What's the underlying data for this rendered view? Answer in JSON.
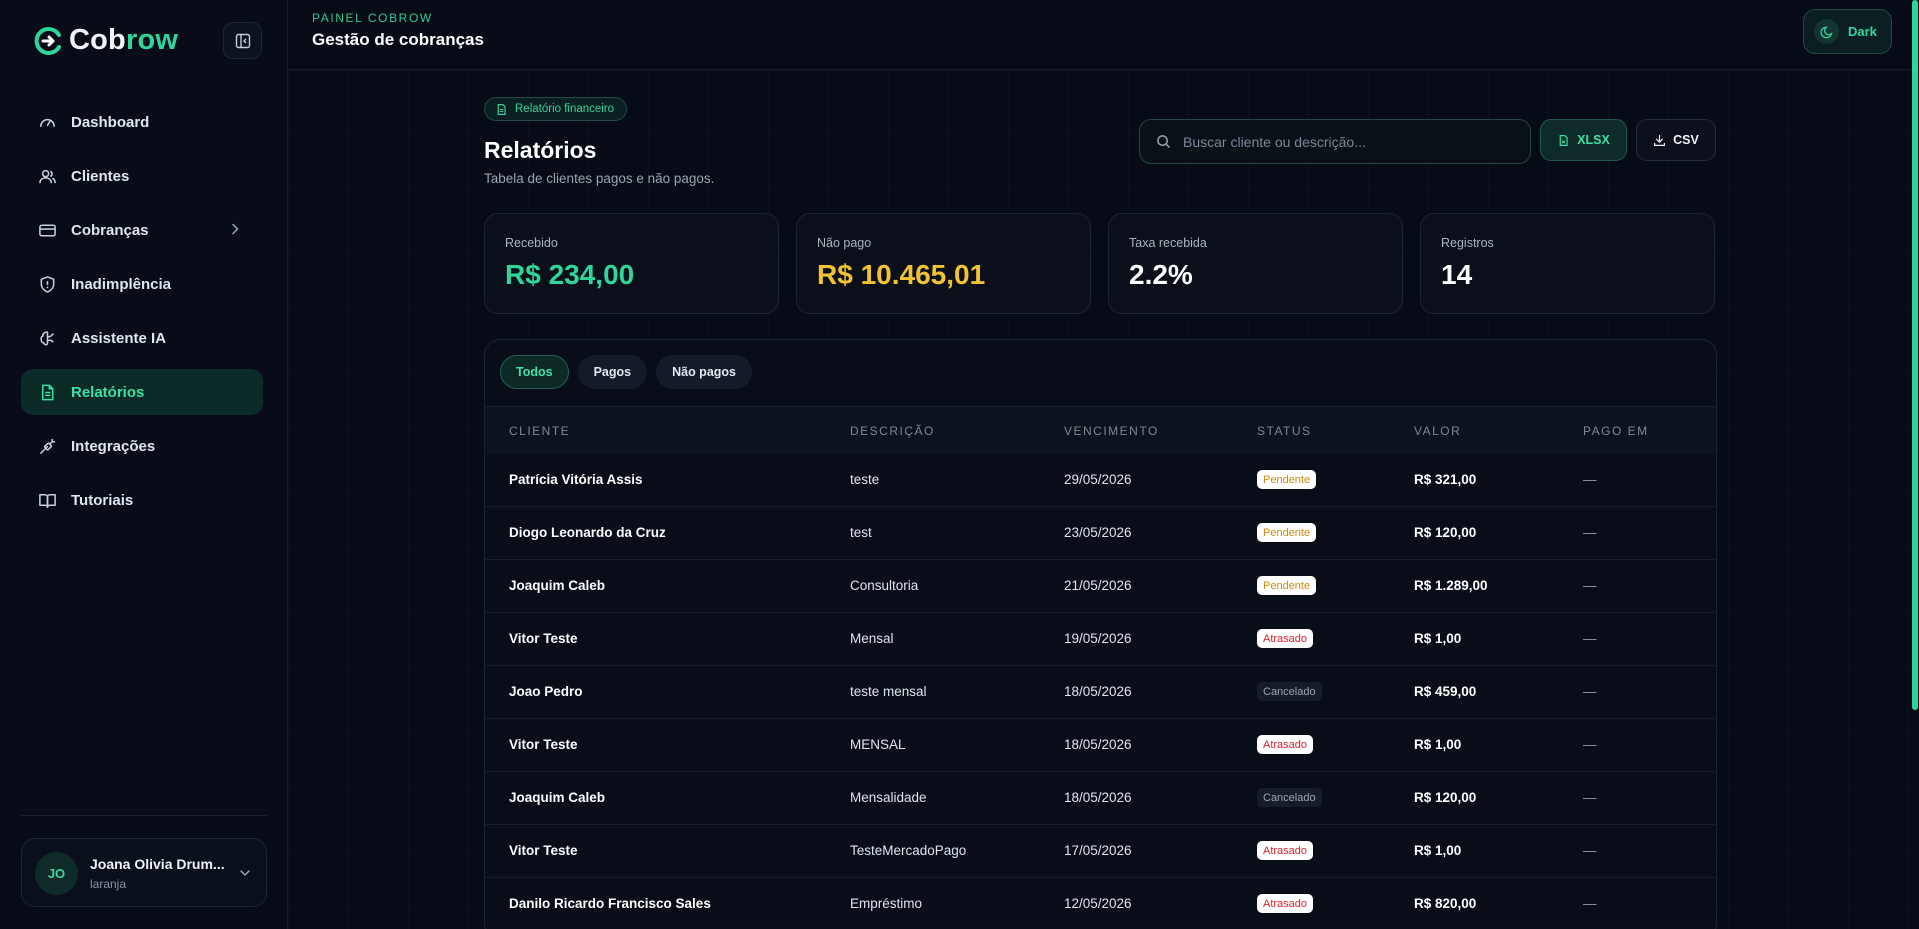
{
  "brand": {
    "part1": "Cob",
    "part2": "row"
  },
  "sidebar": {
    "items": [
      {
        "label": "Dashboard",
        "icon": "gauge-icon"
      },
      {
        "label": "Clientes",
        "icon": "users-icon"
      },
      {
        "label": "Cobranças",
        "icon": "credit-card-icon"
      },
      {
        "label": "Inadimplência",
        "icon": "shield-alert-icon"
      },
      {
        "label": "Assistente IA",
        "icon": "brain-icon"
      },
      {
        "label": "Relatórios",
        "icon": "file-text-icon"
      },
      {
        "label": "Integrações",
        "icon": "plug-icon"
      },
      {
        "label": "Tutoriais",
        "icon": "book-open-icon"
      }
    ],
    "active": "Relatórios"
  },
  "user": {
    "initials": "JO",
    "name": "Joana Olivia Drum...",
    "sub": "laranja"
  },
  "header": {
    "eyebrow": "PAINEL COBROW",
    "title": "Gestão de cobranças",
    "theme_label": "Dark"
  },
  "page": {
    "badge": "Relatório financeiro",
    "title": "Relatórios",
    "subtitle": "Tabela de clientes pagos e não pagos.",
    "search_placeholder": "Buscar cliente ou descrição...",
    "xlsx_label": "XLSX",
    "csv_label": "CSV"
  },
  "stats": [
    {
      "label": "Recebido",
      "value": "R$ 234,00",
      "color": "#2fd69b"
    },
    {
      "label": "Não pago",
      "value": "R$ 10.465,01",
      "color": "#f2c230"
    },
    {
      "label": "Taxa recebida",
      "value": "2.2%",
      "color": "#ffffff"
    },
    {
      "label": "Registros",
      "value": "14",
      "color": "#ffffff"
    }
  ],
  "tabs": [
    {
      "label": "Todos",
      "active": true
    },
    {
      "label": "Pagos",
      "active": false
    },
    {
      "label": "Não pagos",
      "active": false
    }
  ],
  "table": {
    "headers": [
      "CLIENTE",
      "DESCRIÇÃO",
      "VENCIMENTO",
      "STATUS",
      "VALOR",
      "PAGO EM"
    ],
    "rows": [
      {
        "cliente": "Patrícia Vitória Assis",
        "descricao": "teste",
        "vencimento": "29/05/2026",
        "status": "Pendente",
        "valor": "R$ 321,00",
        "pago_em": "—"
      },
      {
        "cliente": "Diogo Leonardo da Cruz",
        "descricao": "test",
        "vencimento": "23/05/2026",
        "status": "Pendente",
        "valor": "R$ 120,00",
        "pago_em": "—"
      },
      {
        "cliente": "Joaquim Caleb",
        "descricao": "Consultoria",
        "vencimento": "21/05/2026",
        "status": "Pendente",
        "valor": "R$ 1.289,00",
        "pago_em": "—"
      },
      {
        "cliente": "Vitor Teste",
        "descricao": "Mensal",
        "vencimento": "19/05/2026",
        "status": "Atrasado",
        "valor": "R$ 1,00",
        "pago_em": "—"
      },
      {
        "cliente": "Joao Pedro",
        "descricao": "teste mensal",
        "vencimento": "18/05/2026",
        "status": "Cancelado",
        "valor": "R$ 459,00",
        "pago_em": "—"
      },
      {
        "cliente": "Vitor Teste",
        "descricao": "MENSAL",
        "vencimento": "18/05/2026",
        "status": "Atrasado",
        "valor": "R$ 1,00",
        "pago_em": "—"
      },
      {
        "cliente": "Joaquim Caleb",
        "descricao": "Mensalidade",
        "vencimento": "18/05/2026",
        "status": "Cancelado",
        "valor": "R$ 120,00",
        "pago_em": "—"
      },
      {
        "cliente": "Vitor Teste",
        "descricao": "TesteMercadoPago",
        "vencimento": "17/05/2026",
        "status": "Atrasado",
        "valor": "R$ 1,00",
        "pago_em": "—"
      },
      {
        "cliente": "Danilo Ricardo Francisco Sales",
        "descricao": "Empréstimo",
        "vencimento": "12/05/2026",
        "status": "Atrasado",
        "valor": "R$ 820,00",
        "pago_em": "—"
      }
    ]
  },
  "colors": {
    "accent": "#2fd69b",
    "warning": "#f2c230",
    "danger": "#d4232b",
    "background": "#060b16"
  }
}
